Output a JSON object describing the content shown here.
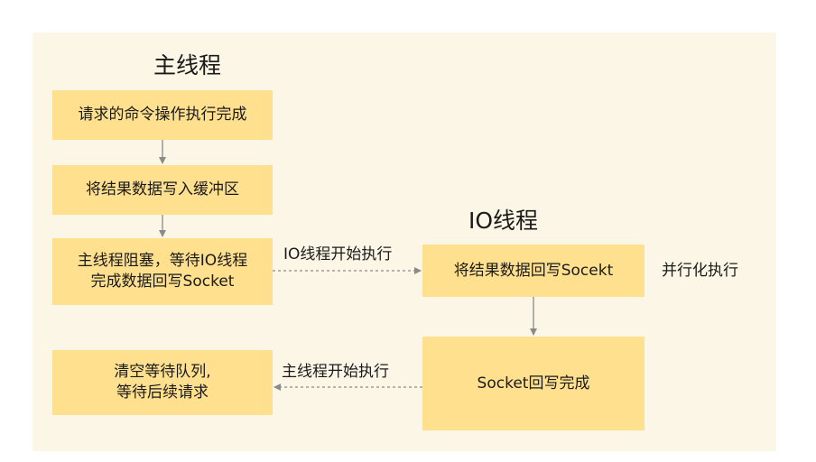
{
  "main_thread": {
    "title": "主线程",
    "steps": [
      "请求的命令操作执行完成",
      "将结果数据写入缓冲区",
      [
        "主线程阻塞，等待IO线程",
        "完成数据回写Socket"
      ],
      [
        "清空等待队列,",
        "等待后续请求"
      ]
    ]
  },
  "io_thread": {
    "title": "IO线程",
    "steps": [
      "将结果数据回写Socekt",
      "Socket回写完成"
    ],
    "side_label": "并行化执行"
  },
  "transitions": {
    "to_io": "IO线程开始执行",
    "to_main": "主线程开始执行"
  },
  "colors": {
    "panel_bg": "#fcf6e6",
    "box_fill": "#ffe08f",
    "arrow": "#8a8a8a"
  }
}
